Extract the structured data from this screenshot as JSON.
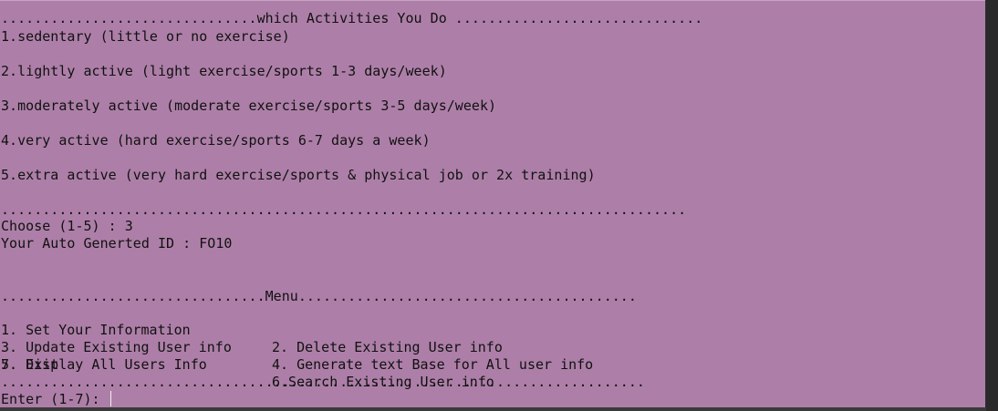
{
  "activities": {
    "header": "...............................which Activities You Do ..............................",
    "options": [
      "1.sedentary (little or no exercise)",
      "2.lightly active (light exercise/sports 1-3 days/week)",
      "3.moderately active (moderate exercise/sports 3-5 days/week)",
      "4.very active (hard exercise/sports 6-7 days a week)",
      "5.extra active (very hard exercise/sports & physical job or 2x training)"
    ],
    "separator": "...................................................................................",
    "prompt": "Choose (1-5) : 3",
    "id_line": "Your Auto Generted ID : FO10"
  },
  "menu": {
    "header": "................................Menu.........................................",
    "items": [
      "1. Set Your Information",
      "2. Delete Existing User info",
      "3. Update Existing User info",
      "4. Generate text Base for All user info",
      "5. Display All Users Info",
      "6.Search Existing User info",
      "7. Exit"
    ],
    "separator": "..............................................................................",
    "prompt": "Enter (1-7): "
  }
}
